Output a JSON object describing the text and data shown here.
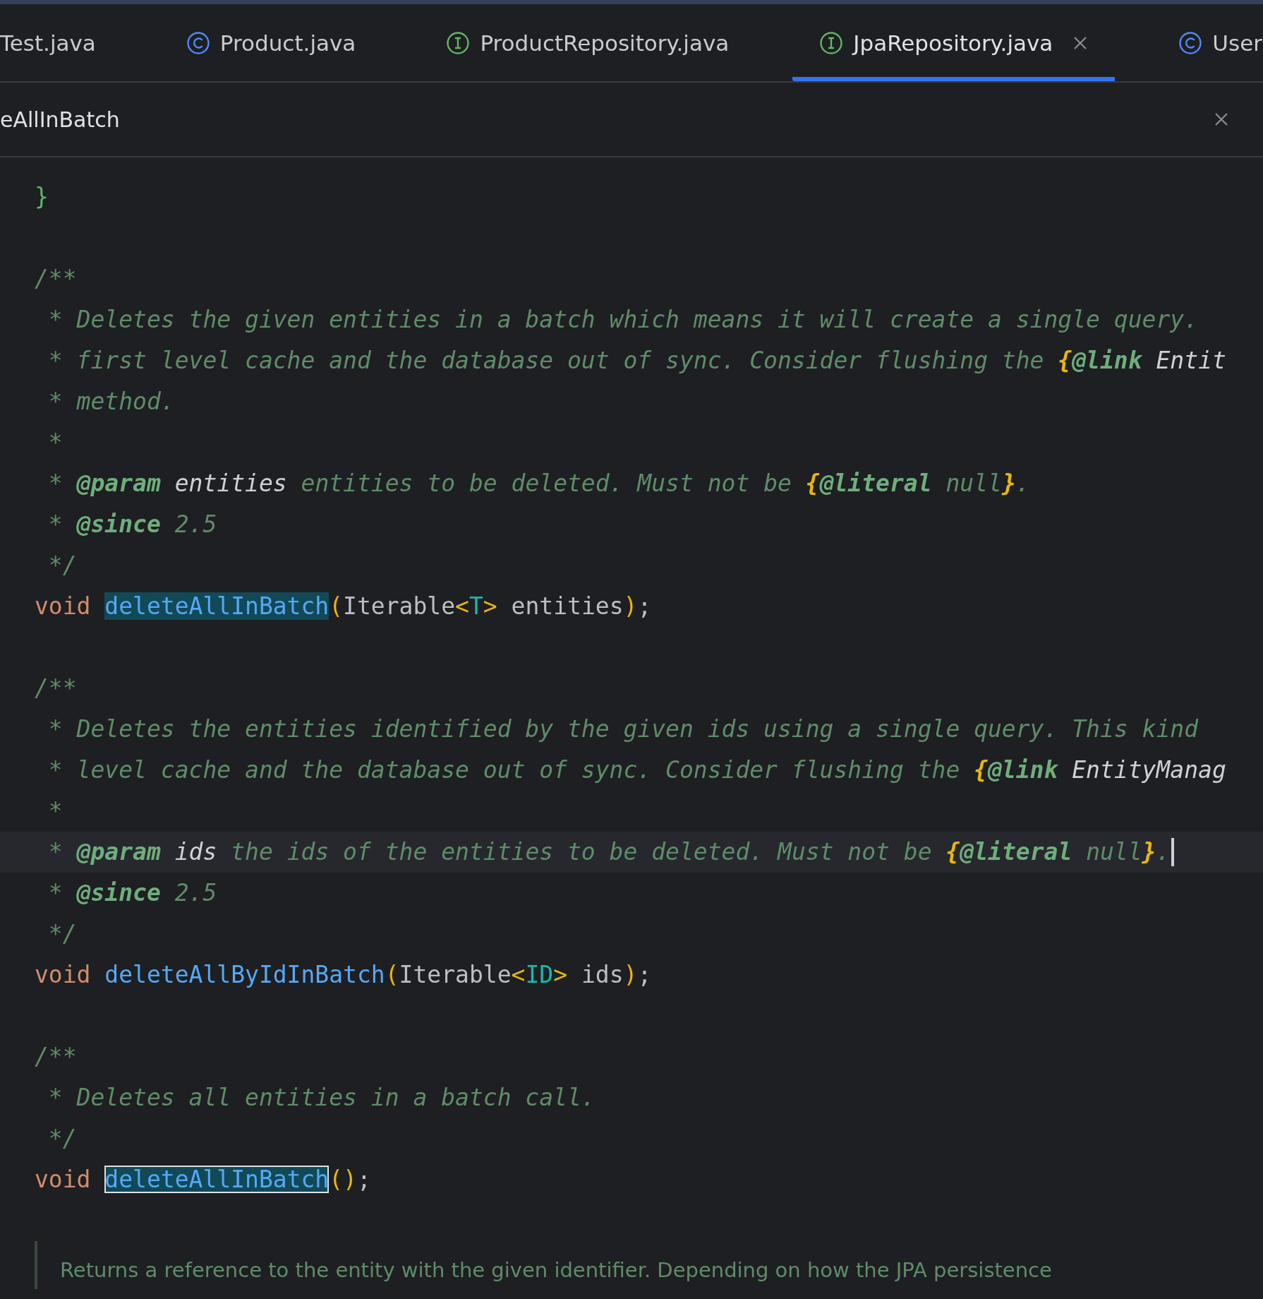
{
  "tabs": [
    {
      "label": "Test.java",
      "selected": false
    },
    {
      "label": "Product.java",
      "kind": "class",
      "selected": false
    },
    {
      "label": "ProductRepository.java",
      "kind": "interface",
      "selected": false
    },
    {
      "label": "JpaRepository.java",
      "kind": "interface",
      "selected": true,
      "closable": true
    },
    {
      "label": "User",
      "kind": "class",
      "selected": false
    }
  ],
  "find_bar": {
    "value": "eAllInBatch"
  },
  "editor": {
    "lines": [
      {
        "current": false,
        "tokens": [
          {
            "kind": "scope-brace",
            "text": "}"
          }
        ]
      },
      {
        "current": false
      },
      {
        "current": false,
        "tokens": [
          {
            "kind": "comment",
            "text": "/**"
          }
        ]
      },
      {
        "current": false,
        "tokens": [
          {
            "kind": "comment",
            "text": " * Deletes the given entities in a batch which means it will create a single query."
          }
        ]
      },
      {
        "current": false,
        "tokens": [
          {
            "kind": "comment",
            "text": " * first level cache and the database out of sync. Consider flushing the "
          },
          {
            "kind": "inline-brace",
            "text": "{"
          },
          {
            "kind": "inline-tag",
            "text": "@link"
          },
          {
            "kind": "link-ref",
            "text": " Entit"
          }
        ]
      },
      {
        "current": false,
        "tokens": [
          {
            "kind": "comment",
            "text": " * method."
          }
        ]
      },
      {
        "current": false,
        "tokens": [
          {
            "kind": "comment",
            "text": " *"
          }
        ]
      },
      {
        "current": false,
        "tokens": [
          {
            "kind": "comment",
            "text": " * "
          },
          {
            "kind": "doc-tag",
            "text": "@param"
          },
          {
            "kind": "param-name",
            "text": " entities"
          },
          {
            "kind": "comment",
            "text": " entities to be deleted. Must not be "
          },
          {
            "kind": "inline-brace",
            "text": "{"
          },
          {
            "kind": "inline-tag",
            "text": "@literal"
          },
          {
            "kind": "comment",
            "text": " null"
          },
          {
            "kind": "inline-brace",
            "text": "}"
          },
          {
            "kind": "comment",
            "text": "."
          }
        ]
      },
      {
        "current": false,
        "tokens": [
          {
            "kind": "comment",
            "text": " * "
          },
          {
            "kind": "doc-tag",
            "text": "@since"
          },
          {
            "kind": "comment",
            "text": " 2.5"
          }
        ]
      },
      {
        "current": false,
        "tokens": [
          {
            "kind": "comment",
            "text": " */"
          }
        ]
      },
      {
        "current": false,
        "tokens": [
          {
            "kind": "keyword",
            "text": "void "
          },
          {
            "kind": "search-match",
            "text": "deleteAllInBatch"
          },
          {
            "kind": "bracket",
            "text": "("
          },
          {
            "kind": "text",
            "text": "Iterable"
          },
          {
            "kind": "bracket",
            "text": "<"
          },
          {
            "kind": "type-param",
            "text": "T"
          },
          {
            "kind": "bracket",
            "text": ">"
          },
          {
            "kind": "text",
            "text": " entities"
          },
          {
            "kind": "bracket",
            "text": ")"
          },
          {
            "kind": "text",
            "text": ";"
          }
        ]
      },
      {
        "current": false
      },
      {
        "current": false,
        "tokens": [
          {
            "kind": "comment",
            "text": "/**"
          }
        ]
      },
      {
        "current": false,
        "tokens": [
          {
            "kind": "comment",
            "text": " * Deletes the entities identified by the given ids using a single query. This kind"
          }
        ]
      },
      {
        "current": false,
        "tokens": [
          {
            "kind": "comment",
            "text": " * level cache and the database out of sync. Consider flushing the "
          },
          {
            "kind": "inline-brace",
            "text": "{"
          },
          {
            "kind": "inline-tag",
            "text": "@link"
          },
          {
            "kind": "link-ref",
            "text": " EntityManag"
          }
        ]
      },
      {
        "current": false,
        "tokens": [
          {
            "kind": "comment",
            "text": " *"
          }
        ]
      },
      {
        "current": true,
        "caret": true,
        "tokens": [
          {
            "kind": "comment",
            "text": " * "
          },
          {
            "kind": "doc-tag",
            "text": "@param"
          },
          {
            "kind": "param-name",
            "text": " ids"
          },
          {
            "kind": "comment",
            "text": " the ids of the entities to be deleted. Must not be "
          },
          {
            "kind": "inline-brace",
            "text": "{"
          },
          {
            "kind": "inline-tag",
            "text": "@literal"
          },
          {
            "kind": "comment",
            "text": " null"
          },
          {
            "kind": "inline-brace",
            "text": "}"
          },
          {
            "kind": "comment",
            "text": "."
          }
        ]
      },
      {
        "current": false,
        "tokens": [
          {
            "kind": "comment",
            "text": " * "
          },
          {
            "kind": "doc-tag",
            "text": "@since"
          },
          {
            "kind": "comment",
            "text": " 2.5"
          }
        ]
      },
      {
        "current": false,
        "tokens": [
          {
            "kind": "comment",
            "text": " */"
          }
        ]
      },
      {
        "current": false,
        "tokens": [
          {
            "kind": "keyword",
            "text": "void "
          },
          {
            "kind": "method",
            "text": "deleteAllByIdInBatch"
          },
          {
            "kind": "bracket",
            "text": "("
          },
          {
            "kind": "text",
            "text": "Iterable"
          },
          {
            "kind": "bracket",
            "text": "<"
          },
          {
            "kind": "type-param",
            "text": "ID"
          },
          {
            "kind": "bracket",
            "text": ">"
          },
          {
            "kind": "text",
            "text": " ids"
          },
          {
            "kind": "bracket",
            "text": ")"
          },
          {
            "kind": "text",
            "text": ";"
          }
        ]
      },
      {
        "current": false
      },
      {
        "current": false,
        "tokens": [
          {
            "kind": "comment",
            "text": "/**"
          }
        ]
      },
      {
        "current": false,
        "tokens": [
          {
            "kind": "comment",
            "text": " * Deletes all entities in a batch call."
          }
        ]
      },
      {
        "current": false,
        "tokens": [
          {
            "kind": "comment",
            "text": " */"
          }
        ]
      },
      {
        "current": false,
        "tokens": [
          {
            "kind": "keyword",
            "text": "void "
          },
          {
            "kind": "current-match",
            "text": "deleteAllInBatch"
          },
          {
            "kind": "bracket",
            "text": "()"
          },
          {
            "kind": "text",
            "text": ";"
          }
        ]
      },
      {
        "current": false
      }
    ]
  },
  "rendered_doc": {
    "text": "Returns a reference to the entity with the given identifier. Depending on how the JPA persistence"
  }
}
